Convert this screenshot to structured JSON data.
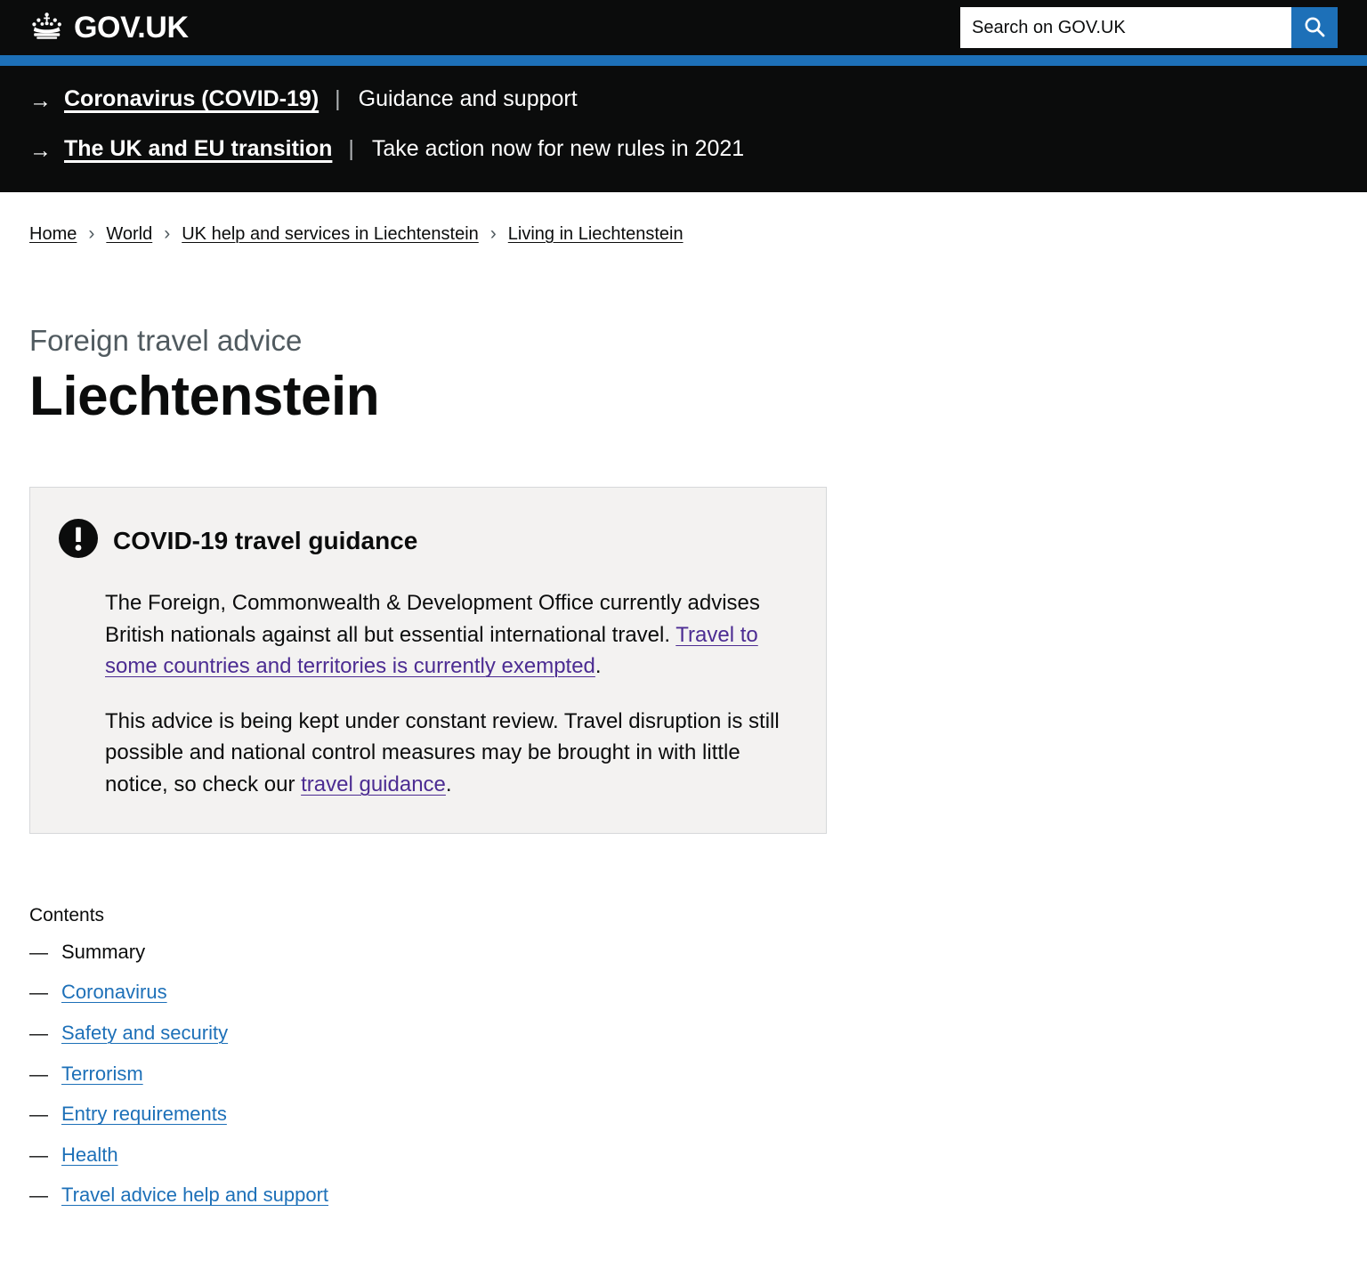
{
  "header": {
    "brand_label": "GOV.UK",
    "crown_icon": "crown-icon",
    "search": {
      "placeholder": "Search on GOV.UK",
      "value": "",
      "button_icon": "search-icon"
    },
    "accent_color": "#1d70b8"
  },
  "notices": [
    {
      "arrow": "→",
      "link_label": "Coronavirus (COVID-19)",
      "separator": "|",
      "description": "Guidance and support"
    },
    {
      "arrow": "→",
      "link_label": "The UK and EU transition",
      "separator": "|",
      "description": "Take action now for new rules in 2021"
    }
  ],
  "breadcrumbs": {
    "chevron": "›",
    "items": [
      {
        "label": "Home"
      },
      {
        "label": "World"
      },
      {
        "label": "UK help and services in Liechtenstein"
      },
      {
        "label": "Living in Liechtenstein"
      }
    ]
  },
  "page": {
    "context_title": "Foreign travel advice",
    "title": "Liechtenstein"
  },
  "callout": {
    "icon": "exclamation-circle-icon",
    "title": "COVID-19 travel guidance",
    "paragraph1": {
      "bold_text": "The Foreign, Commonwealth & Development Office currently advises British nationals against all but essential international travel.",
      "link_text": "Travel to some countries and territories is currently exempted",
      "trailing_text": "."
    },
    "paragraph2": {
      "text_before": "This advice is being kept under constant review. Travel disruption is still possible and national control measures may be brought in with little notice, so check our ",
      "link_text": "travel guidance",
      "trailing_text": "."
    },
    "background_color": "#f3f2f1",
    "link_color": "#4c2c92"
  },
  "contents": {
    "heading": "Contents",
    "dash": "—",
    "link_color": "#1d70b8",
    "items": [
      {
        "label": "Summary",
        "current": true
      },
      {
        "label": "Coronavirus",
        "current": false
      },
      {
        "label": "Safety and security",
        "current": false
      },
      {
        "label": "Terrorism",
        "current": false
      },
      {
        "label": "Entry requirements",
        "current": false
      },
      {
        "label": "Health",
        "current": false
      },
      {
        "label": "Travel advice help and support",
        "current": false
      }
    ]
  }
}
